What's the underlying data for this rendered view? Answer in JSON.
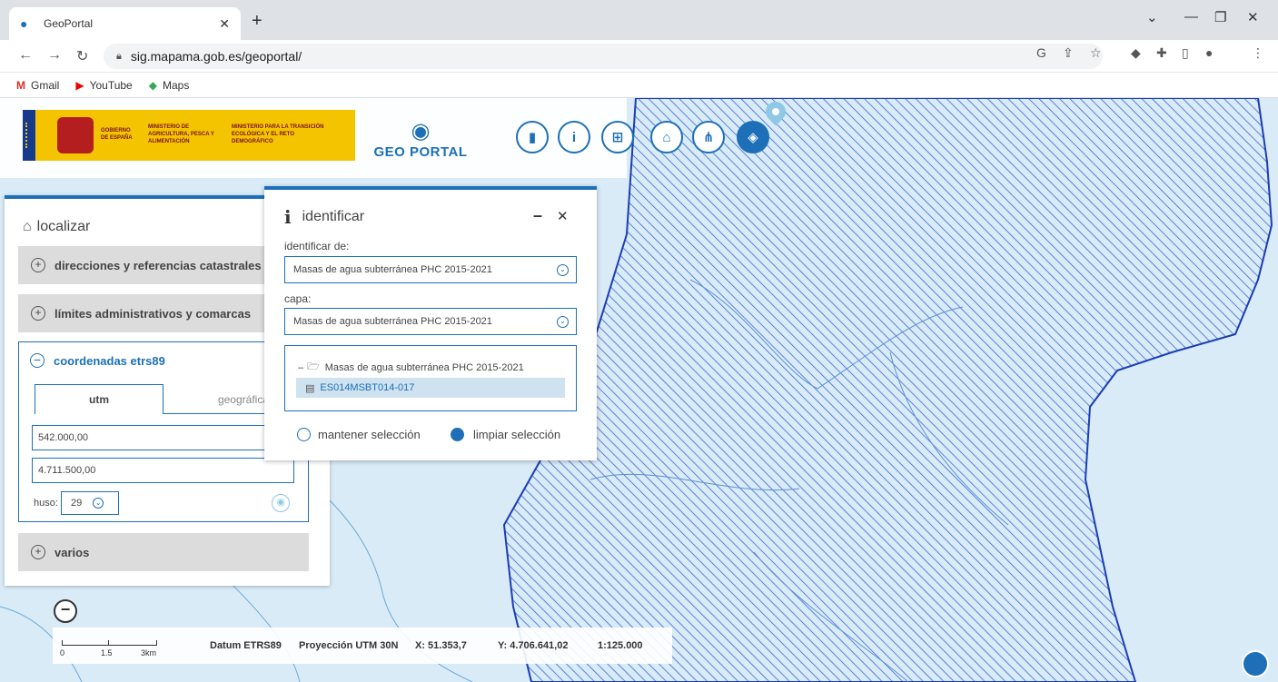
{
  "browser": {
    "tab_title": "GeoPortal",
    "url": "sig.mapama.gob.es/geoportal/",
    "bookmarks": [
      {
        "icon": "gmail-icon",
        "label": "Gmail"
      },
      {
        "icon": "youtube-icon",
        "label": "YouTube"
      },
      {
        "icon": "maps-icon",
        "label": "Maps"
      }
    ]
  },
  "header": {
    "gov_lines": [
      "GOBIERNO DE ESPAÑA",
      "MINISTERIO DE AGRICULTURA, PESCA Y ALIMENTACIÓN",
      "MINISTERIO PARA LA TRANSICIÓN ECOLÓGICA Y EL RETO DEMOGRÁFICO"
    ],
    "geoportal_label": "GEO PORTAL",
    "tools": [
      "ruler-icon",
      "info-icon",
      "bookmark-icon",
      "map-search-icon",
      "tree-icon",
      "layers-icon"
    ]
  },
  "localizar": {
    "title": "localizar",
    "sections": {
      "direcciones": "direcciones y referencias catastrales",
      "limites": "límites administrativos y comarcas",
      "coordenadas": "coordenadas etrs89",
      "varios": "varios"
    },
    "tabs": {
      "utm": "utm",
      "geograficas": "geográficas"
    },
    "x_value": "542.000,00",
    "y_value": "4.711.500,00",
    "huso_label": "huso:",
    "huso_value": "29"
  },
  "identificar": {
    "title": "identificar",
    "de_label": "identificar de:",
    "de_value": "Masas de agua subterránea PHC 2015-2021",
    "capa_label": "capa:",
    "capa_value": "Masas de agua subterránea PHC 2015-2021",
    "tree_root": "Masas de agua subterránea PHC 2015-2021",
    "tree_leaf": "ES014MSBT014-017",
    "keep_selection": "mantener selección",
    "clear_selection": "limpiar selección"
  },
  "status": {
    "scale_labels": [
      "0",
      "1.5",
      "3km"
    ],
    "datum": "Datum ETRS89",
    "projection": "Proyección UTM 30N",
    "x": "X: 51.353,7",
    "y": "Y: 4.706.641,02",
    "scale": "1:125.000"
  }
}
